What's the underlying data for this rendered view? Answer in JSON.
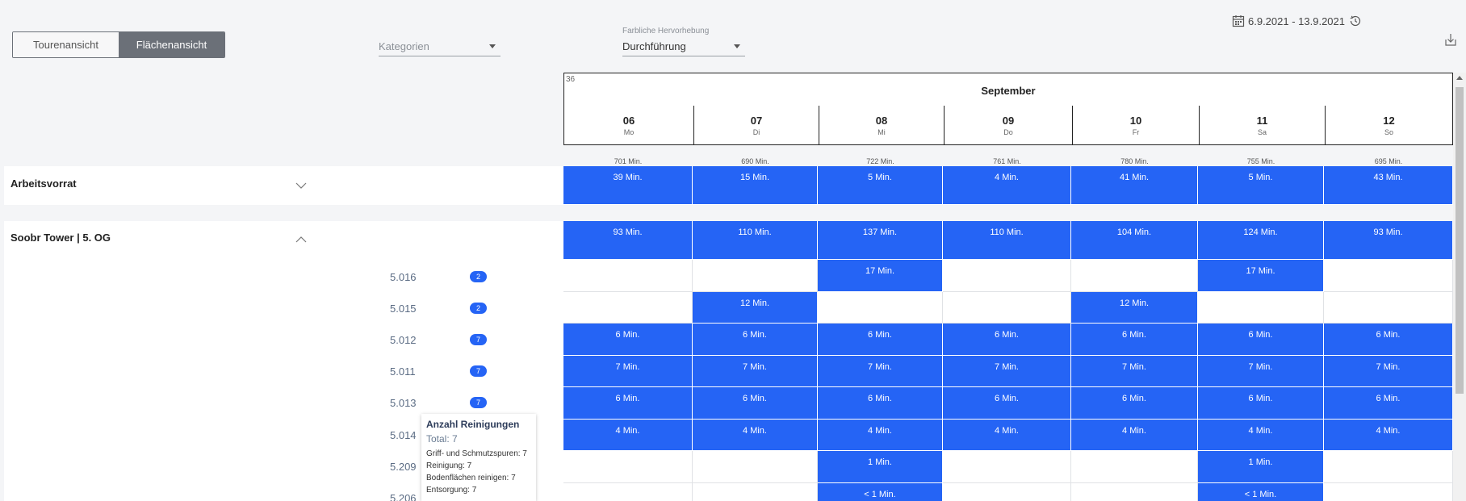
{
  "toolbar": {
    "view_tabs": [
      "Tourenansicht",
      "Flächenansicht"
    ],
    "active_view": "Flächenansicht",
    "kategorien_placeholder": "Kategorien",
    "highlight_label": "Farbliche Hervorhebung",
    "highlight_value": "Durchführung",
    "date_range": "6.9.2021 - 13.9.2021"
  },
  "calendar": {
    "week_number": "36",
    "month": "September",
    "days": [
      {
        "num": "06",
        "wd": "Mo",
        "total": "701 Min."
      },
      {
        "num": "07",
        "wd": "Di",
        "total": "690 Min."
      },
      {
        "num": "08",
        "wd": "Mi",
        "total": "722 Min."
      },
      {
        "num": "09",
        "wd": "Do",
        "total": "761 Min."
      },
      {
        "num": "10",
        "wd": "Fr",
        "total": "780 Min."
      },
      {
        "num": "11",
        "wd": "Sa",
        "total": "755 Min."
      },
      {
        "num": "12",
        "wd": "So",
        "total": "695 Min."
      }
    ]
  },
  "groups": [
    {
      "label": "Arbeitsvorrat",
      "expanded": false,
      "cells": [
        "39 Min.",
        "15 Min.",
        "5 Min.",
        "4 Min.",
        "41 Min.",
        "5 Min.",
        "43 Min."
      ]
    },
    {
      "label": "Soobr Tower | 5. OG",
      "expanded": true,
      "cells": [
        "93 Min.",
        "110 Min.",
        "137 Min.",
        "110 Min.",
        "104 Min.",
        "124 Min.",
        "93 Min."
      ]
    }
  ],
  "rooms": [
    {
      "label": "5.016",
      "badge": "2",
      "cells": [
        "",
        "",
        "17 Min.",
        "",
        "",
        "17 Min.",
        ""
      ]
    },
    {
      "label": "5.015",
      "badge": "2",
      "cells": [
        "",
        "12 Min.",
        "",
        "",
        "12 Min.",
        "",
        ""
      ]
    },
    {
      "label": "5.012",
      "badge": "7",
      "cells": [
        "6 Min.",
        "6 Min.",
        "6 Min.",
        "6 Min.",
        "6 Min.",
        "6 Min.",
        "6 Min."
      ]
    },
    {
      "label": "5.011",
      "badge": "7",
      "cells": [
        "7 Min.",
        "7 Min.",
        "7 Min.",
        "7 Min.",
        "7 Min.",
        "7 Min.",
        "7 Min."
      ]
    },
    {
      "label": "5.013",
      "badge": "7",
      "cells": [
        "6 Min.",
        "6 Min.",
        "6 Min.",
        "6 Min.",
        "6 Min.",
        "6 Min.",
        "6 Min."
      ]
    },
    {
      "label": "5.014",
      "badge": "",
      "cells": [
        "4 Min.",
        "4 Min.",
        "4 Min.",
        "4 Min.",
        "4 Min.",
        "4 Min.",
        "4 Min."
      ]
    },
    {
      "label": "5.209",
      "badge": "",
      "cells": [
        "",
        "",
        "1 Min.",
        "",
        "",
        "1 Min.",
        ""
      ]
    },
    {
      "label": "5.206",
      "badge": "",
      "cells": [
        "",
        "",
        "< 1 Min.",
        "",
        "",
        "< 1 Min.",
        ""
      ]
    }
  ],
  "tooltip": {
    "title": "Anzahl Reinigungen",
    "total": "Total: 7",
    "lines": [
      "Griff- und Schmutzspuren: 7",
      "Reinigung: 7",
      "Bodenflächen reinigen: 7",
      "Entsorgung: 7"
    ]
  },
  "colors": {
    "accent": "#2564f5",
    "segment_active": "#6b7078"
  }
}
